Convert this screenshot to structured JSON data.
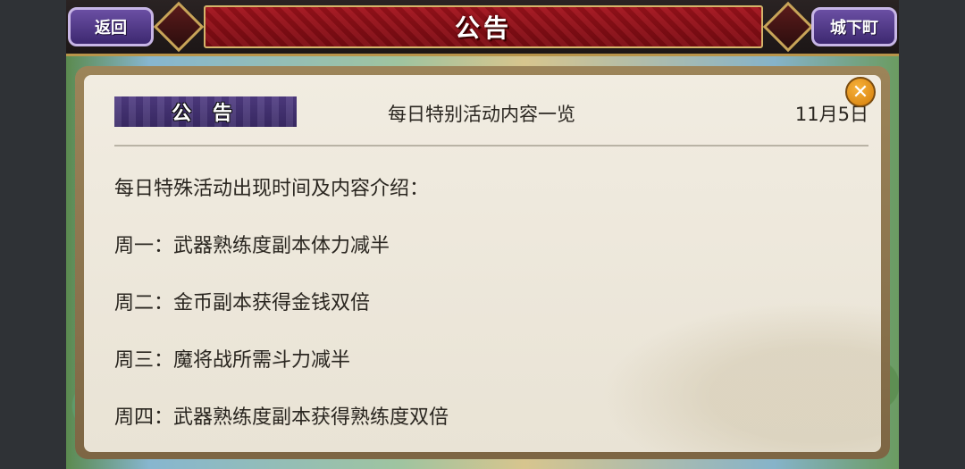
{
  "header": {
    "title": "公告",
    "back_label": "返回",
    "town_label": "城下町"
  },
  "notice": {
    "tag_label": "公 告",
    "headline": "每日特别活动内容一览",
    "date": "11月5日",
    "close_icon": "close-icon",
    "lines": [
      "每日特殊活动出现时间及内容介绍：",
      "周一：武器熟练度副本体力减半",
      "周二：金币副本获得金钱双倍",
      "周三：魔将战所需斗力减半",
      "周四：武器熟练度副本获得熟练度双倍"
    ]
  },
  "colors": {
    "title_banner": "#9a1018",
    "nav_button": "#4f3b82",
    "tag": "#3f2e6e",
    "close_button": "#e8940f",
    "paper": "#efe9dd"
  }
}
